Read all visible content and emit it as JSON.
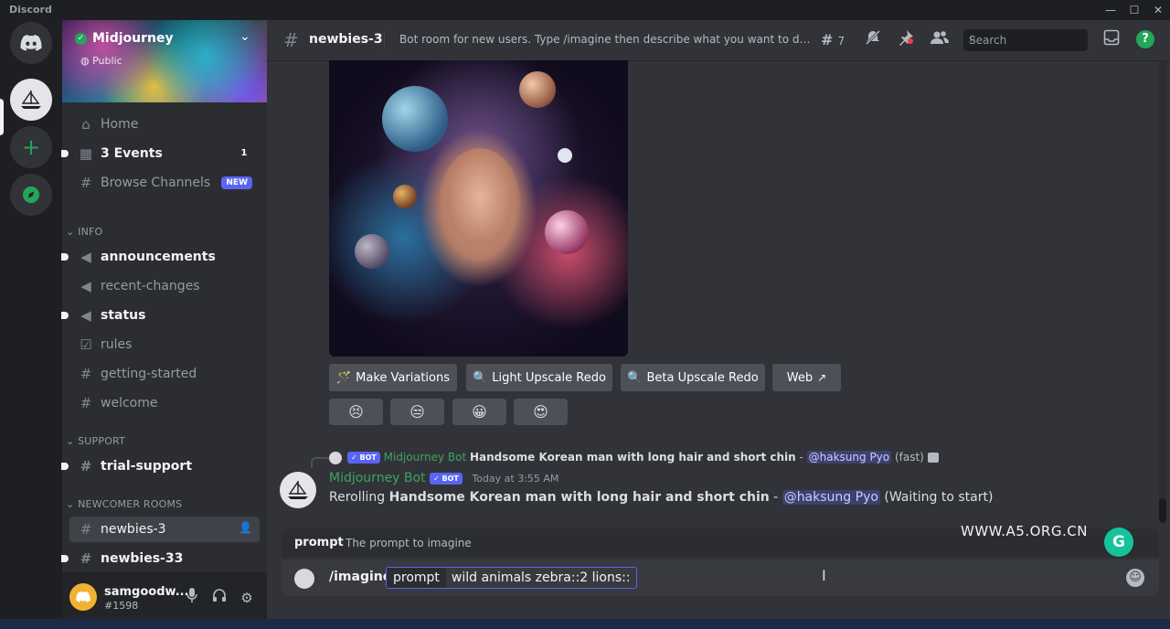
{
  "window": {
    "app_title": "Discord",
    "min": "—",
    "max": "☐",
    "close": "✕"
  },
  "server": {
    "name": "Midjourney",
    "visibility": "Public"
  },
  "nav": {
    "home": "Home",
    "events": "3 Events",
    "events_badge": "1",
    "browse": "Browse Channels",
    "browse_badge": "NEW"
  },
  "categories": {
    "info": "INFO",
    "support": "SUPPORT",
    "newcomer": "NEWCOMER ROOMS"
  },
  "channels": {
    "announcements": "announcements",
    "recent_changes": "recent-changes",
    "status": "status",
    "rules": "rules",
    "getting_started": "getting-started",
    "welcome": "welcome",
    "trial_support": "trial-support",
    "newbies_3": "newbies-3",
    "newbies_33": "newbies-33"
  },
  "user": {
    "name": "samgoodw...",
    "tag": "#1598"
  },
  "header": {
    "channel": "newbies-3",
    "topic": "Bot room for new users. Type /imagine then describe what you want to draw. S...",
    "threads_count": "7",
    "search_placeholder": "Search",
    "help": "?"
  },
  "components": {
    "make_variations": "Make Variations",
    "light_upscale_redo": "Light Upscale Redo",
    "beta_upscale_redo": "Beta Upscale Redo",
    "web": "Web"
  },
  "reactions": [
    "😣",
    "😒",
    "😀",
    "😍"
  ],
  "reply": {
    "badge": "✓ BOT",
    "author": "Midjourney Bot",
    "prompt": "Handsome Korean man with long hair and short chin",
    "sep": " - ",
    "mention": "@haksung Pyo",
    "speed": "(fast)"
  },
  "message": {
    "author": "Midjourney Bot",
    "badge": "✓ BOT",
    "timestamp": "Today at 3:55 AM",
    "prefix": "Rerolling ",
    "prompt": "Handsome Korean man with long hair and short chin",
    "sep": " - ",
    "mention": "@haksung Pyo",
    "status": " (Waiting to start)"
  },
  "prompt_hint": {
    "key": "prompt",
    "desc": "The prompt to imagine"
  },
  "composer": {
    "command": "/imagine",
    "option": "prompt",
    "value": "wild animals zebra::2 lions::"
  },
  "watermark": "WWW.A5.ORG.CN",
  "grammarly": "G"
}
